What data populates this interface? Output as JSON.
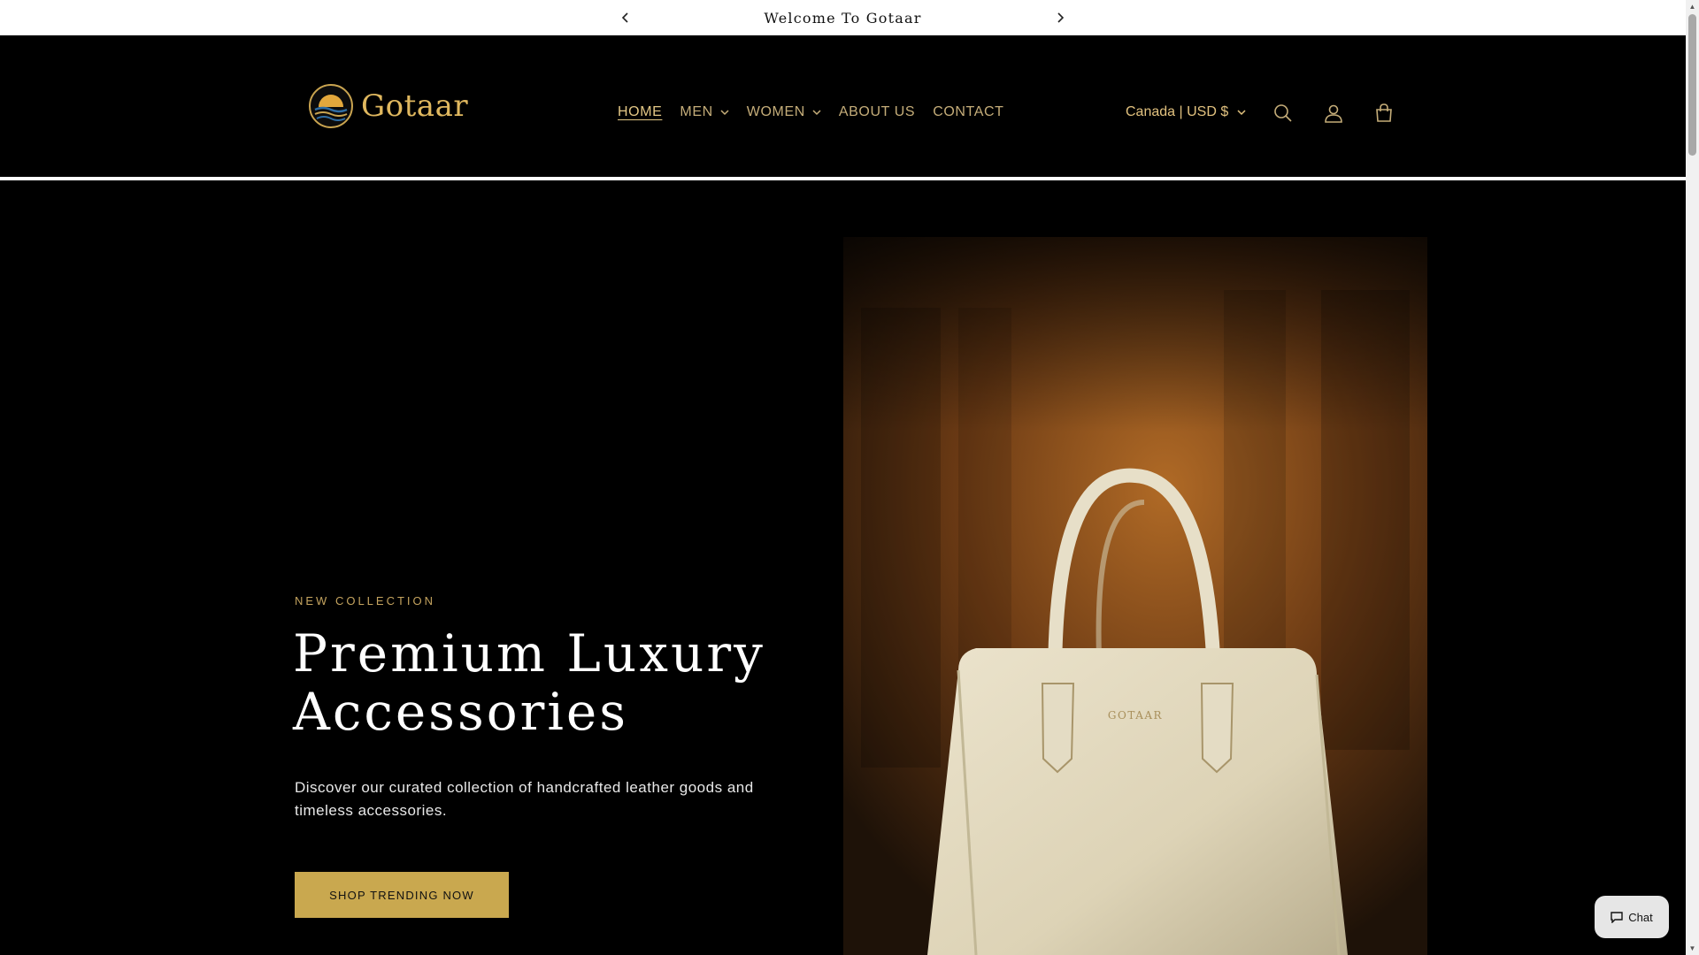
{
  "announcement": {
    "message": "Welcome To Gotaar"
  },
  "header": {
    "logo_text": "Gotaar",
    "nav": [
      {
        "label": "HOME",
        "active": true,
        "has_dropdown": false
      },
      {
        "label": "MEN",
        "active": false,
        "has_dropdown": true
      },
      {
        "label": "WOMEN",
        "active": false,
        "has_dropdown": true
      },
      {
        "label": "ABOUT US",
        "active": false,
        "has_dropdown": false
      },
      {
        "label": "CONTACT",
        "active": false,
        "has_dropdown": false
      }
    ],
    "country_selector": "Canada | USD $",
    "icons": [
      "search-icon",
      "account-icon",
      "cart-icon"
    ]
  },
  "hero": {
    "kicker": "NEW COLLECTION",
    "headline": "Premium Luxury Accessories",
    "subtext": "Discover our curated collection of handcrafted leather goods and timeless accessories.",
    "cta_label": "SHOP TRENDING NOW",
    "image_brand_mark": "GOTAAR"
  },
  "chat": {
    "label": "Chat"
  },
  "colors": {
    "background": "#000000",
    "accent_gold": "#c9a84f",
    "nav_text": "#c5ad79",
    "announcement_bg": "#ffffff"
  }
}
